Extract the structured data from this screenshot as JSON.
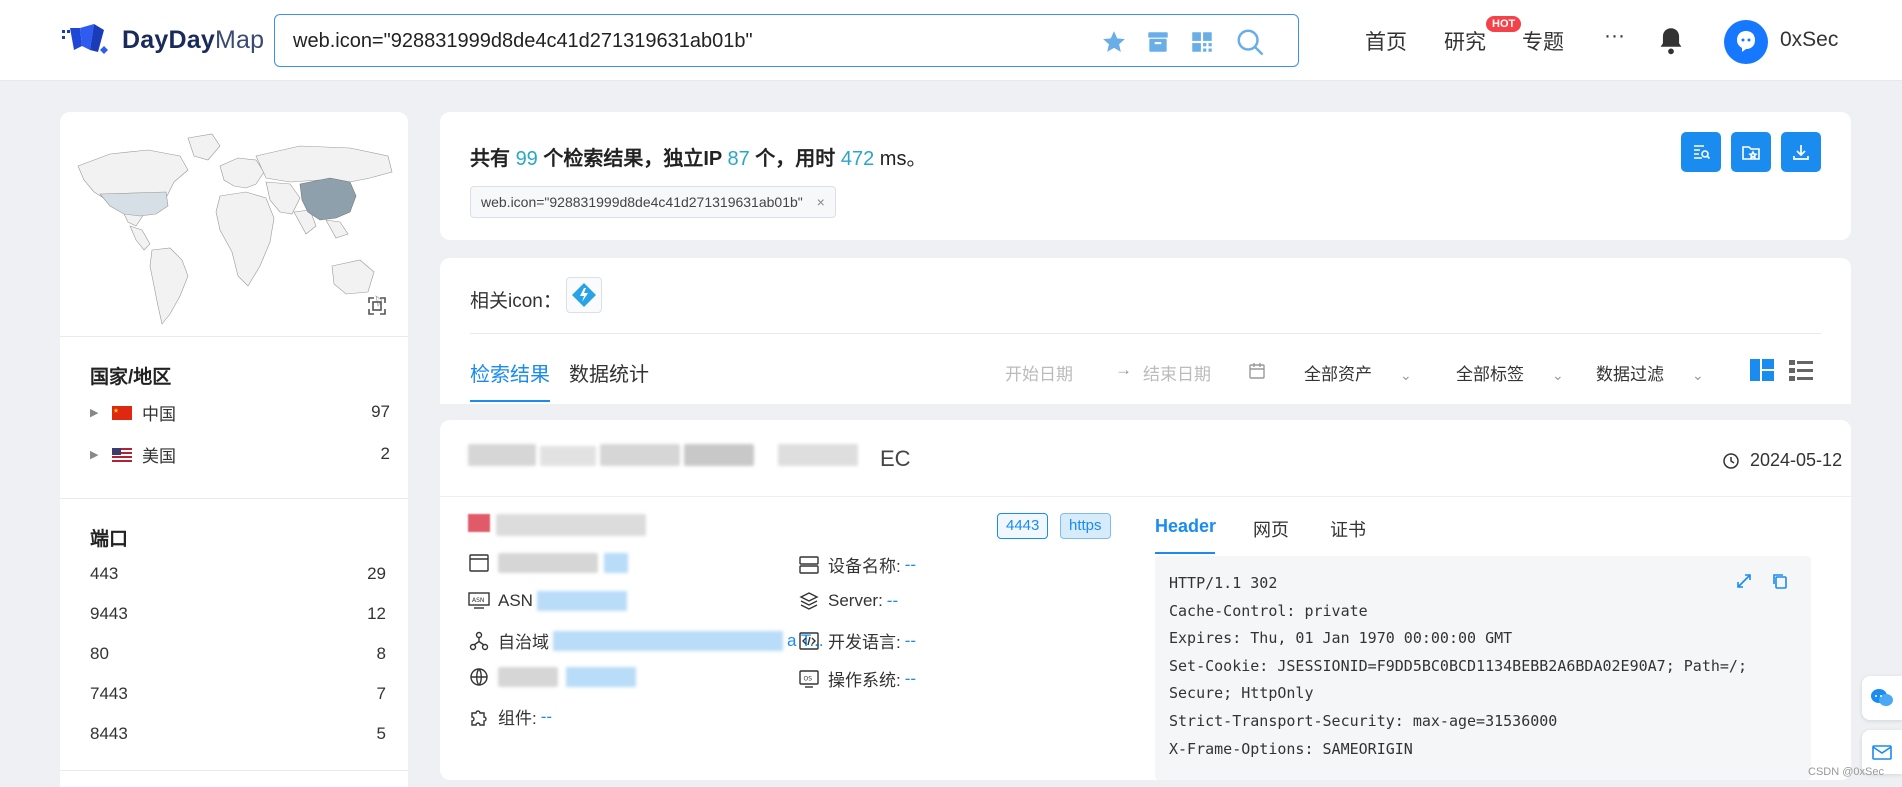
{
  "brand": {
    "name_bold": "DayDay",
    "name_light": "Map"
  },
  "search": {
    "query": "web.icon=\"928831999d8de4c41d271319631ab01b\""
  },
  "nav": {
    "home": "首页",
    "research": "研究",
    "hot_badge": "HOT",
    "topics": "专题",
    "more": "···",
    "username": "0xSec"
  },
  "sidebar": {
    "country_title": "国家/地区",
    "countries": [
      {
        "name": "中国",
        "count": "97"
      },
      {
        "name": "美国",
        "count": "2"
      }
    ],
    "port_title": "端口",
    "ports": [
      {
        "port": "443",
        "count": "29"
      },
      {
        "port": "9443",
        "count": "12"
      },
      {
        "port": "80",
        "count": "8"
      },
      {
        "port": "7443",
        "count": "7"
      },
      {
        "port": "8443",
        "count": "5"
      }
    ]
  },
  "summary": {
    "prefix": "共有",
    "total": "99",
    "mid1": "个检索结果，独立IP",
    "ip_count": "87",
    "mid2": "个，用时",
    "time": "472",
    "suffix": "ms。",
    "chip": "web.icon=\"928831999d8de4c41d271319631ab01b\"",
    "chip_close": "×"
  },
  "filter": {
    "related_icon_label": "相关icon：",
    "tab_results": "检索结果",
    "tab_stats": "数据统计",
    "start_date": "开始日期",
    "arrow": "→",
    "end_date": "结束日期",
    "assets": "全部资产",
    "tags": "全部标签",
    "data_filter": "数据过滤"
  },
  "result": {
    "title_suffix": "EC",
    "date": "2024-05-12",
    "port_tag": "4443",
    "proto_tag": "https",
    "device_label": "设备名称:",
    "device_value": "--",
    "server_label": "Server:",
    "server_value": "--",
    "lang_label": "开发语言:",
    "lang_value": "--",
    "os_label": "操作系统:",
    "os_value": "--",
    "component_label": "组件:",
    "component_value": "--",
    "asn_prefix": "ASN",
    "autonomous_prefix": "自治域",
    "autonomous_tail": "a T...",
    "tabs": [
      "Header",
      "网页",
      "证书"
    ],
    "header_text": "HTTP/1.1 302\nCache-Control: private\nExpires: Thu, 01 Jan 1970 00:00:00 GMT\nSet-Cookie: JSESSIONID=F9DD5BC0BCD1134BEBB2A6BDA02E90A7; Path=/;\nSecure; HttpOnly\nStrict-Transport-Security: max-age=31536000\nX-Frame-Options: SAMEORIGIN"
  },
  "watermark": "CSDN @0xSec",
  "colors": {
    "accent": "#1a8cf0",
    "number": "#29a6c9",
    "hot": "#f5424a"
  }
}
